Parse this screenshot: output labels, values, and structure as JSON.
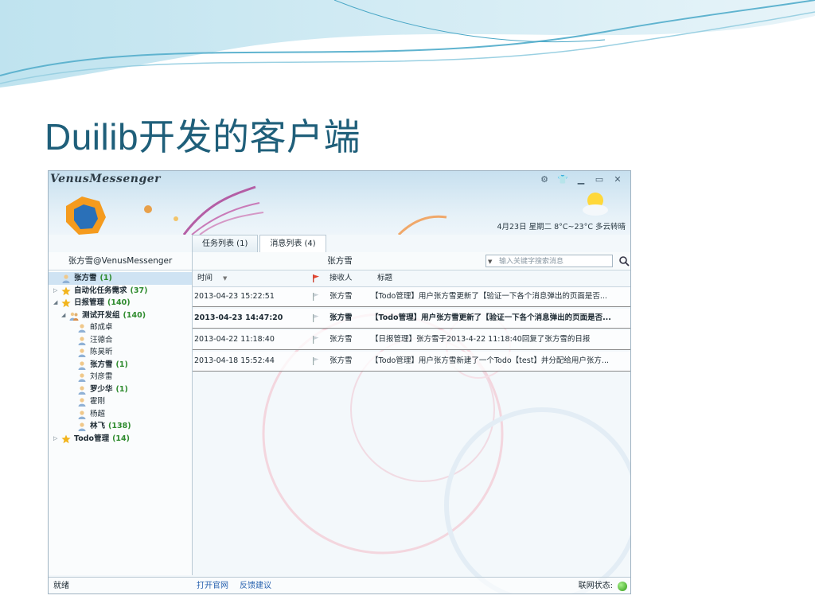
{
  "slide": {
    "title": "Duilib开发的客户端"
  },
  "window": {
    "app_name": "VenusMessenger",
    "sys_buttons": [
      "gear-icon",
      "shirt-icon",
      "minimize-icon",
      "maximize-icon",
      "close-icon"
    ],
    "weather": "4月23日 星期二 8°C~23°C 多云转晴"
  },
  "tabs": [
    {
      "label": "任务列表 (1)",
      "active": false
    },
    {
      "label": "消息列表 (4)",
      "active": true
    }
  ],
  "sidebar": {
    "header": "张方雪@VenusMessenger",
    "tree": [
      {
        "label": "张方雪",
        "count": "(1)",
        "level": 0,
        "icon": "user",
        "arrow": "",
        "bold": true,
        "selected": true
      },
      {
        "label": "自动化任务需求",
        "count": "(37)",
        "level": 0,
        "icon": "star",
        "arrow": "▷",
        "bold": true
      },
      {
        "label": "日报管理",
        "count": "(140)",
        "level": 0,
        "icon": "star",
        "arrow": "◢",
        "bold": true
      },
      {
        "label": "测试开发组",
        "count": "(140)",
        "level": 1,
        "icon": "group",
        "arrow": "◢",
        "bold": true
      },
      {
        "label": "邮成卓",
        "count": "",
        "level": 2,
        "icon": "user",
        "arrow": ""
      },
      {
        "label": "汪德合",
        "count": "",
        "level": 2,
        "icon": "user",
        "arrow": ""
      },
      {
        "label": "陈昊昕",
        "count": "",
        "level": 2,
        "icon": "user",
        "arrow": ""
      },
      {
        "label": "张方雪",
        "count": "(1)",
        "level": 2,
        "icon": "user",
        "arrow": "",
        "bold": true
      },
      {
        "label": "刘彦雷",
        "count": "",
        "level": 2,
        "icon": "user",
        "arrow": ""
      },
      {
        "label": "罗少华",
        "count": "(1)",
        "level": 2,
        "icon": "user",
        "arrow": "",
        "bold": true
      },
      {
        "label": "霍刚",
        "count": "",
        "level": 2,
        "icon": "user",
        "arrow": ""
      },
      {
        "label": "杨超",
        "count": "",
        "level": 2,
        "icon": "user",
        "arrow": ""
      },
      {
        "label": "林飞",
        "count": "(138)",
        "level": 2,
        "icon": "user",
        "arrow": "",
        "bold": true
      },
      {
        "label": "Todo管理",
        "count": "(14)",
        "level": 0,
        "icon": "star",
        "arrow": "▷",
        "bold": true
      }
    ]
  },
  "main": {
    "title": "张方雪",
    "search_placeholder": "输入关键字搜索消息",
    "columns": {
      "time": "时间",
      "recipient": "接收人",
      "subject": "标题"
    },
    "rows": [
      {
        "time": "2013-04-23 15:22:51",
        "recipient": "张方雪",
        "subject": "【Todo管理】用户张方雪更新了【验证一下各个消息弹出的页面是否...",
        "bold": false
      },
      {
        "time": "2013-04-23 14:47:20",
        "recipient": "张方雪",
        "subject": "【Todo管理】用户张方雪更新了【验证一下各个消息弹出的页面是否...",
        "bold": true
      },
      {
        "time": "2013-04-22 11:18:40",
        "recipient": "张方雪",
        "subject": "【日报管理】张方雪于2013-4-22 11:18:40回复了张方雪的日报",
        "bold": false
      },
      {
        "time": "2013-04-18 15:52:44",
        "recipient": "张方雪",
        "subject": "【Todo管理】用户张方雪新建了一个Todo【test】并分配给用户张方...",
        "bold": false
      }
    ]
  },
  "statusbar": {
    "status": "就绪",
    "link_website": "打开官网",
    "link_feedback": "反馈建议",
    "network_label": "联网状态:",
    "network_status_color": "#2f9a14"
  }
}
